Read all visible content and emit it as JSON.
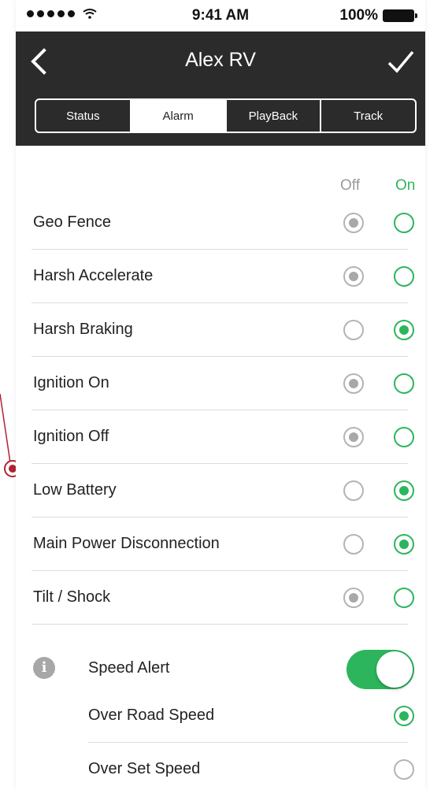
{
  "status_bar": {
    "time": "9:41 AM",
    "battery": "100%"
  },
  "nav": {
    "title": "Alex RV"
  },
  "tabs": [
    {
      "label": "Status",
      "active": false
    },
    {
      "label": "Alarm",
      "active": true
    },
    {
      "label": "PlayBack",
      "active": false
    },
    {
      "label": "Track",
      "active": false
    }
  ],
  "columns": {
    "off": "Off",
    "on": "On"
  },
  "alarms": [
    {
      "label": "Geo Fence",
      "state": "off"
    },
    {
      "label": "Harsh Accelerate",
      "state": "off"
    },
    {
      "label": "Harsh Braking",
      "state": "on"
    },
    {
      "label": "Ignition On",
      "state": "off"
    },
    {
      "label": "Ignition Off",
      "state": "off"
    },
    {
      "label": "Low Battery",
      "state": "on"
    },
    {
      "label": "Main Power Disconnection",
      "state": "on"
    },
    {
      "label": "Tilt / Shock",
      "state": "off"
    }
  ],
  "speed_alert": {
    "label": "Speed Alert",
    "enabled": true,
    "options": [
      {
        "label": "Over Road Speed",
        "selected": true
      },
      {
        "label": "Over Set Speed",
        "selected": false
      }
    ]
  },
  "colors": {
    "accent": "#2db55d",
    "nav_bg": "#2b2b2b",
    "muted": "#a8a8a8",
    "annotation": "#b22233"
  }
}
